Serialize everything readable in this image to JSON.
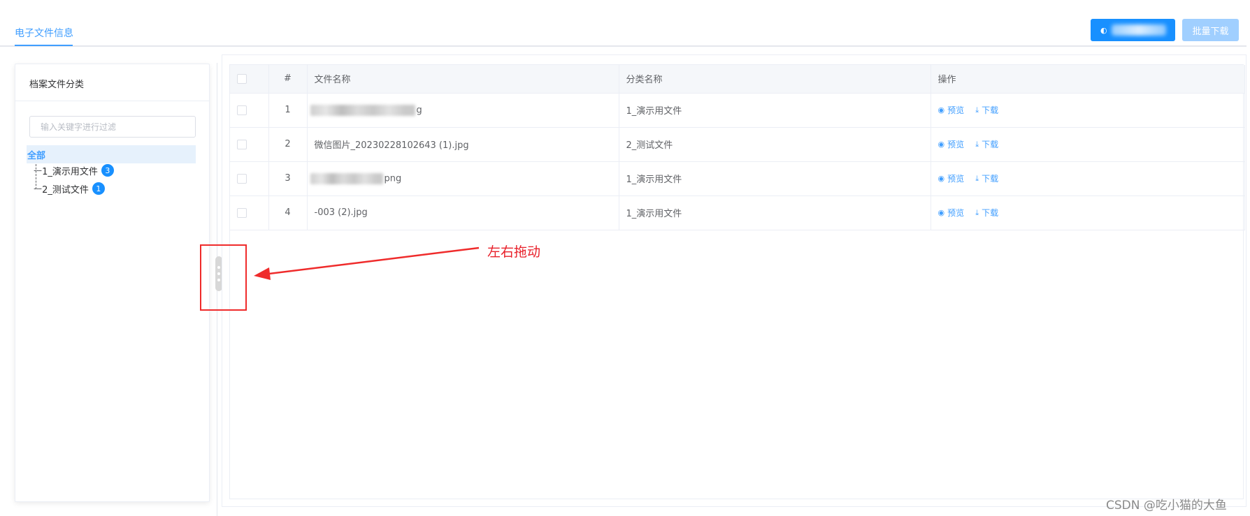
{
  "tabs": {
    "active_label": "电子文件信息"
  },
  "toolbar": {
    "primary_button_label": "",
    "batch_download_label": "批量下载"
  },
  "left_panel": {
    "title": "档案文件分类",
    "filter_placeholder": "输入关键字进行过滤",
    "tree": {
      "root_label": "全部",
      "nodes": [
        {
          "label": "1_演示用文件",
          "count": "3"
        },
        {
          "label": "2_测试文件",
          "count": "1"
        }
      ]
    }
  },
  "table": {
    "headers": {
      "index": "#",
      "file_name": "文件名称",
      "category": "分类名称",
      "actions": "操作"
    },
    "rows": [
      {
        "index": "1",
        "file_name": "g",
        "category": "1_演示用文件"
      },
      {
        "index": "2",
        "file_name": "微信图片_20230228102643 (1).jpg",
        "category": "2_测试文件"
      },
      {
        "index": "3",
        "file_name": "png",
        "category": "1_演示用文件"
      },
      {
        "index": "4",
        "file_name": "-003 (2).jpg",
        "category": "1_演示用文件"
      }
    ],
    "actions": {
      "preview": "预览",
      "download": "下载"
    }
  },
  "annotation": {
    "label": "左右拖动",
    "color": "#e8202a"
  },
  "watermark": "CSDN @吃小猫的大鱼",
  "colors": {
    "primary": "#1890ff",
    "link": "#409eff",
    "disabled": "#a0cfff",
    "annotation_red": "#ef2b2b"
  }
}
